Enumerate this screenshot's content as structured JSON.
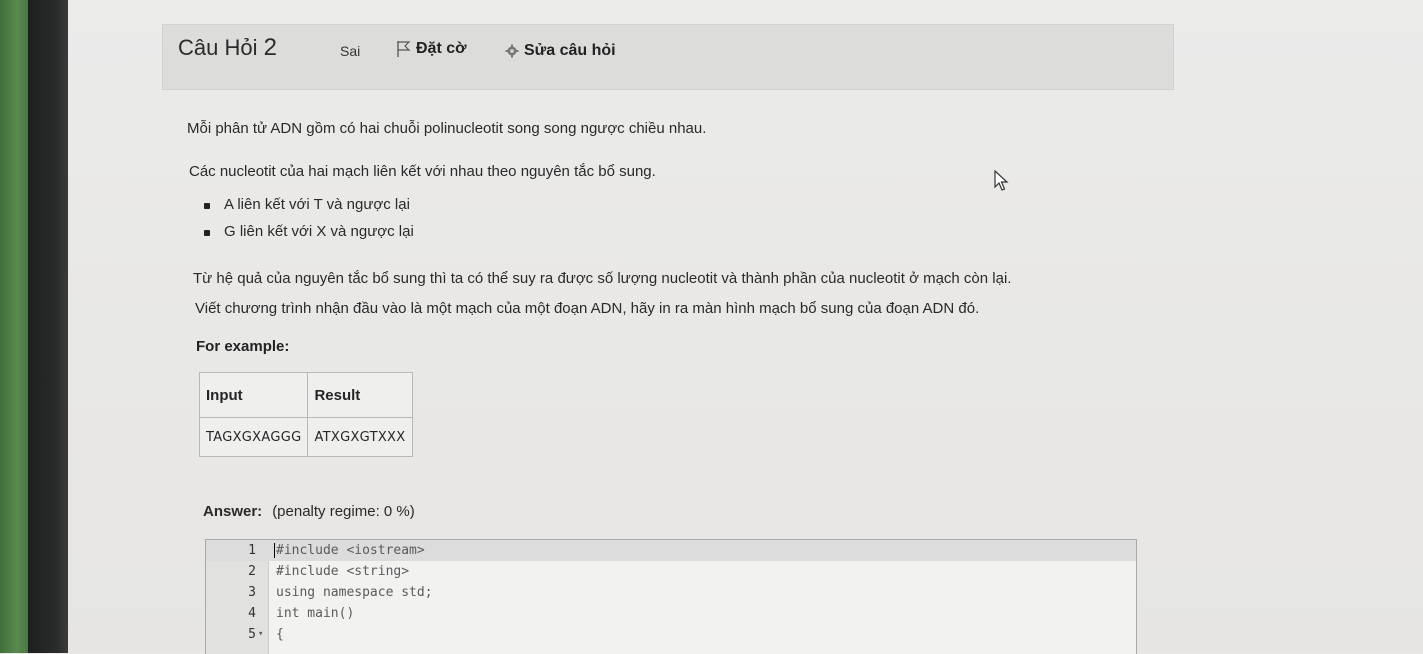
{
  "question": {
    "title_prefix": "Câu Hỏi",
    "number": "2",
    "status": "Sai",
    "flag_label": "Đặt cờ",
    "edit_label": "Sửa câu hỏi"
  },
  "content": {
    "p1": "Mỗi phân tử ADN gồm có hai chuỗi polinucleotit  song song ngược chiều nhau.",
    "p2": "Các nucleotit của hai mạch liên kết với nhau theo nguyên tắc bổ sung.",
    "bullets": [
      "A liên kết với T và ngược lại",
      "G liên kết với  X và ngược lại"
    ],
    "p3": "Từ hệ quả của nguyên tắc bổ sung thì ta có thể suy ra được số lượng nucleotit và thành phần của nucleotit ở mạch còn lại.",
    "p4": "Viết chương trình nhận đầu vào là một mạch của một đoạn ADN, hãy in ra màn hình mạch bổ sung của đoạn ADN đó.",
    "for_example": "For example:"
  },
  "example_table": {
    "headers": [
      "Input",
      "Result"
    ],
    "rows": [
      [
        "TAGXGXAGGG",
        "ATXGXGTXXX"
      ]
    ]
  },
  "answer": {
    "label": "Answer:",
    "penalty": "(penalty regime: 0 %)"
  },
  "editor": {
    "lines": [
      {
        "num": "1",
        "code": "#include <iostream>",
        "fold": ""
      },
      {
        "num": "2",
        "code": "#include <string>",
        "fold": ""
      },
      {
        "num": "3",
        "code": "using namespace std;",
        "fold": ""
      },
      {
        "num": "4",
        "code": "int main()",
        "fold": ""
      },
      {
        "num": "5",
        "code": "{",
        "fold": "▾"
      }
    ]
  },
  "icons": {
    "flag": "flag-icon",
    "edit": "gear-icon",
    "pointer": "mouse-pointer-icon"
  }
}
